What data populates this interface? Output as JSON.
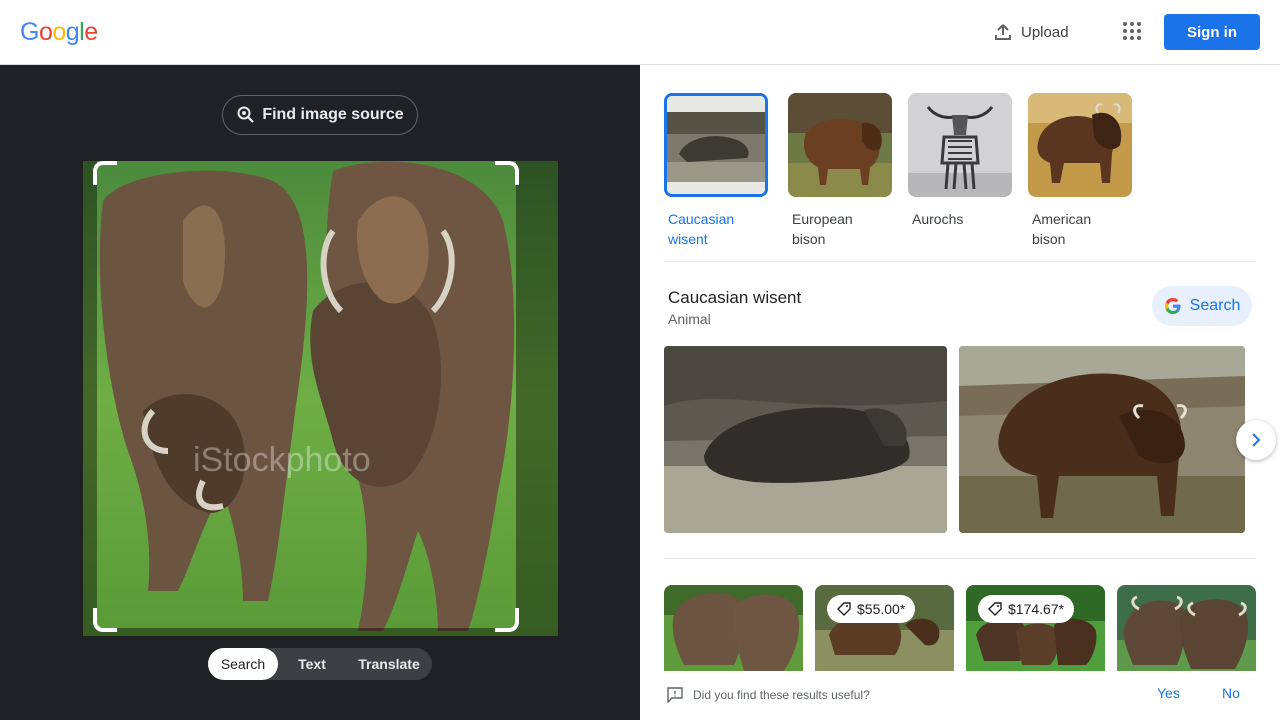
{
  "header": {
    "logo_letters": [
      {
        "ch": "G",
        "color": "#4285F4"
      },
      {
        "ch": "o",
        "color": "#EA4335"
      },
      {
        "ch": "o",
        "color": "#FBBC05"
      },
      {
        "ch": "g",
        "color": "#4285F4"
      },
      {
        "ch": "l",
        "color": "#34A853"
      },
      {
        "ch": "e",
        "color": "#EA4335"
      }
    ],
    "upload_label": "Upload",
    "upload_icon": "upload-icon",
    "apps_icon": "apps-grid-icon",
    "signin_label": "Sign in"
  },
  "left_panel": {
    "find_source_label": "Find image source",
    "find_source_icon": "lens-search-icon",
    "watermark": "iStockphoto",
    "modes": [
      {
        "label": "Search",
        "active": true
      },
      {
        "label": "Text",
        "active": false
      },
      {
        "label": "Translate",
        "active": false
      }
    ]
  },
  "entities": [
    {
      "label": "Caucasian wisent",
      "selected": true
    },
    {
      "label": "European bison",
      "selected": false
    },
    {
      "label": "Aurochs",
      "selected": false
    },
    {
      "label": "American bison",
      "selected": false
    }
  ],
  "entity_panel": {
    "title": "Caucasian wisent",
    "subtitle": "Animal",
    "search_label": "Search",
    "search_icon": "google-g-icon",
    "next_icon": "chevron-right-icon"
  },
  "results": [
    {
      "price": ""
    },
    {
      "price": "$55.00*"
    },
    {
      "price": "$174.67*"
    },
    {
      "price": ""
    }
  ],
  "feedback": {
    "icon": "feedback-icon",
    "question": "Did you find these results useful?",
    "yes_label": "Yes",
    "no_label": "No"
  },
  "colors": {
    "accent_blue": "#1a73e8",
    "dark_panel": "#202124"
  }
}
